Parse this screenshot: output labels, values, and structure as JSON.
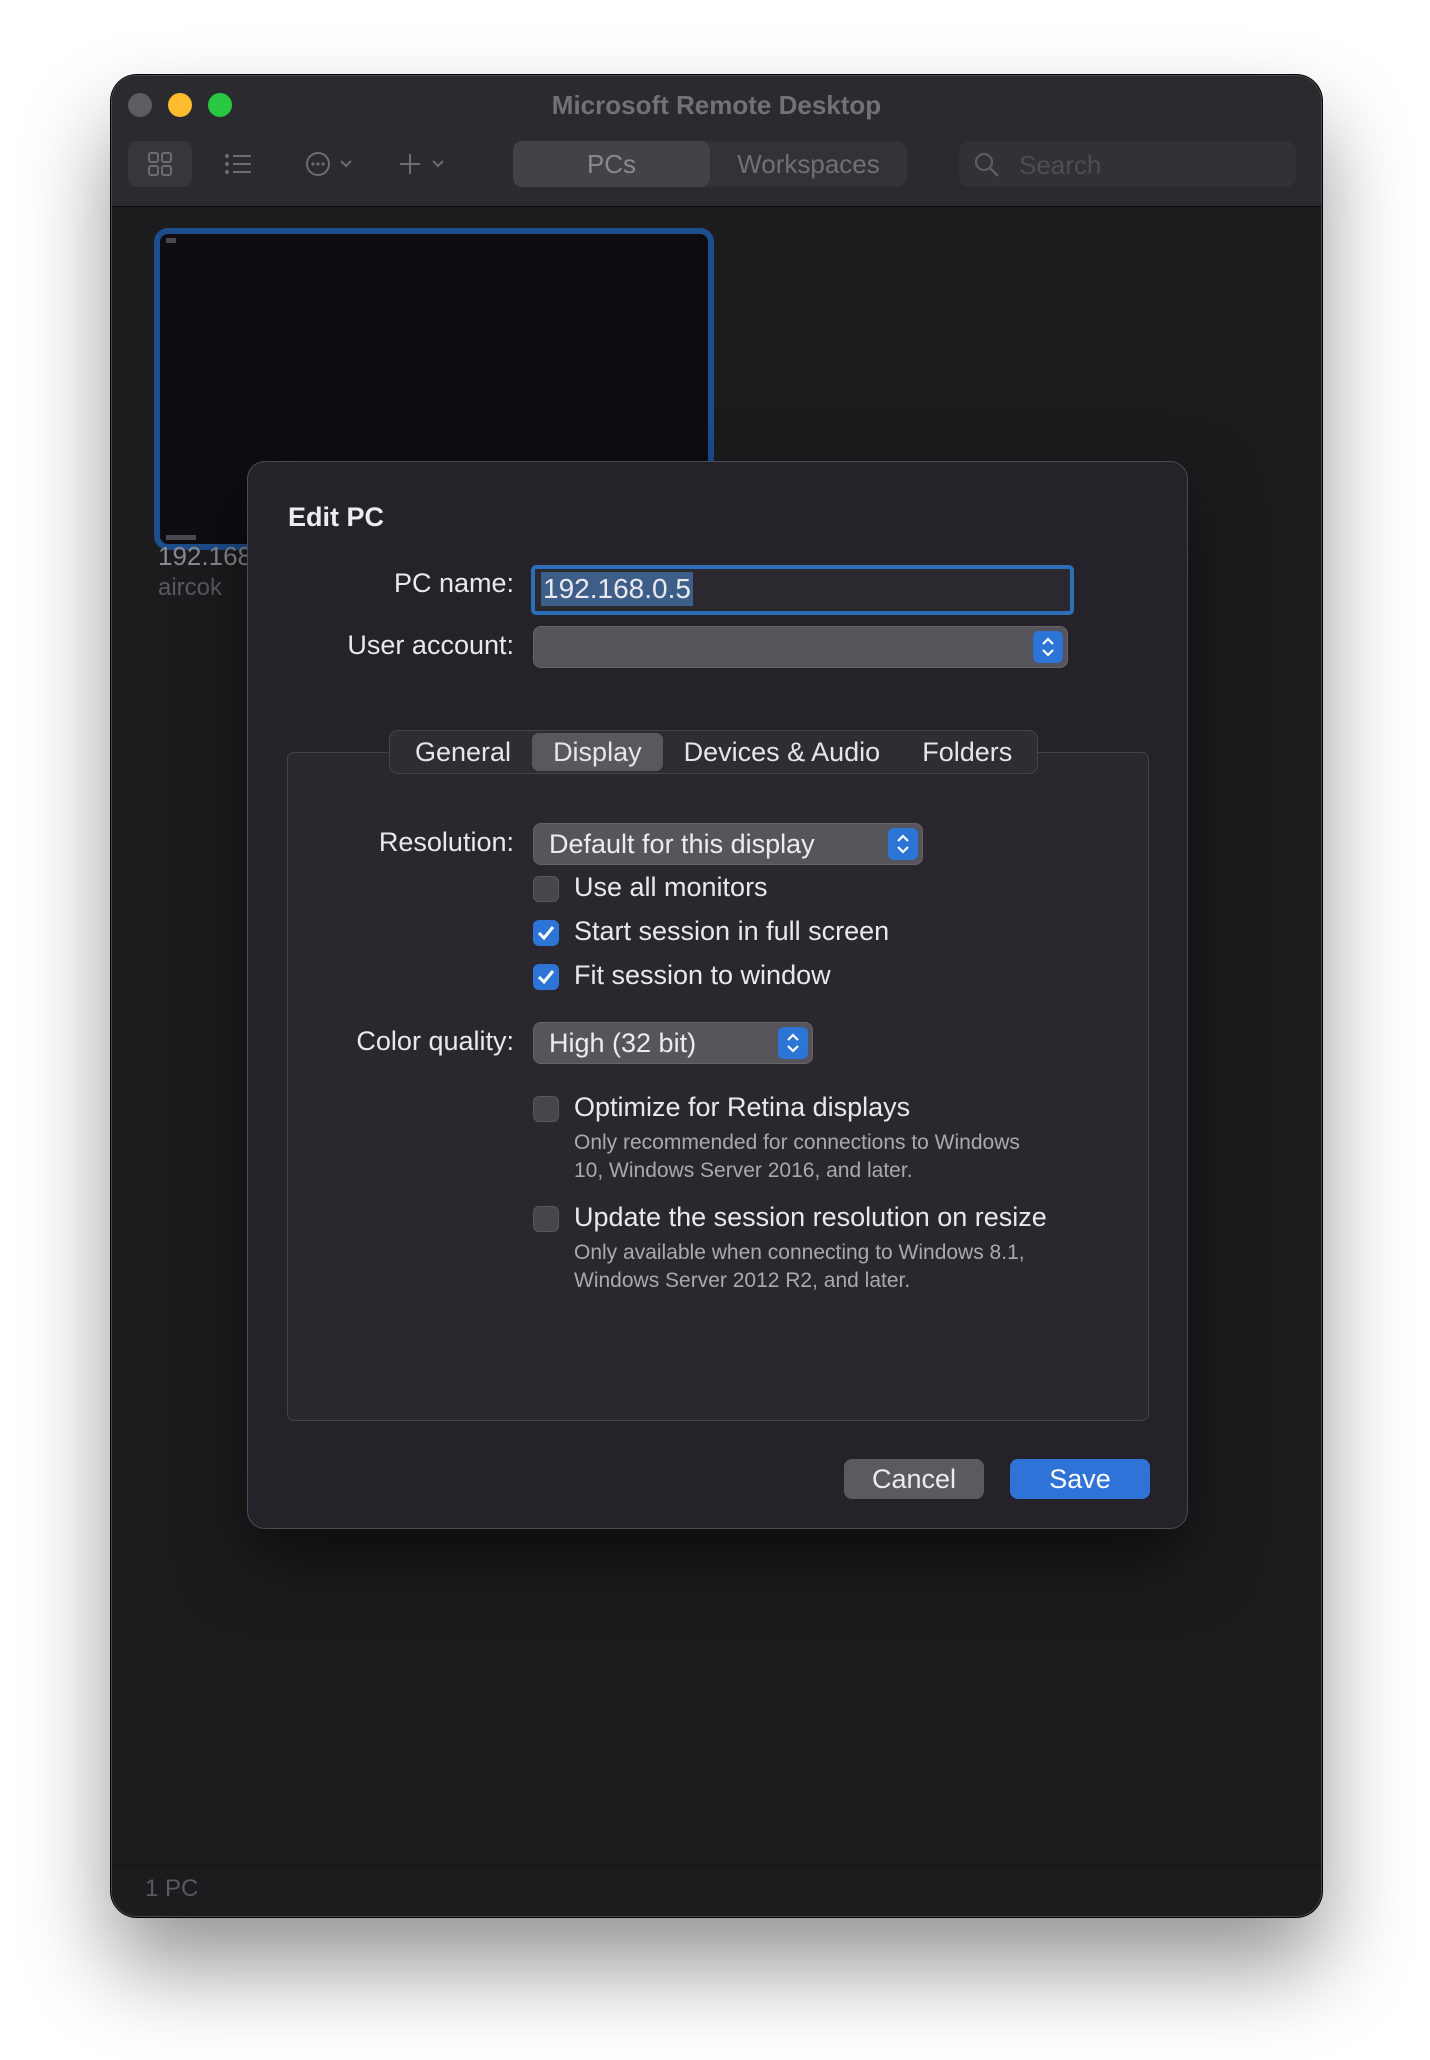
{
  "window": {
    "title": "Microsoft Remote Desktop"
  },
  "toolbar": {
    "icons": [
      "grid-view-icon",
      "list-view-icon",
      "more-options-icon",
      "add-icon"
    ],
    "segments": [
      "PCs",
      "Workspaces"
    ],
    "active_segment": "PCs",
    "search_placeholder": "Search"
  },
  "pc_tile": {
    "name": "192.168",
    "user": "aircok"
  },
  "status": {
    "count": "1 PC"
  },
  "dialog": {
    "title": "Edit PC",
    "pc_name_label": "PC name:",
    "pc_name_value": "192.168.0.5",
    "user_account_label": "User account:",
    "user_account_value": "",
    "tabs": [
      "General",
      "Display",
      "Devices & Audio",
      "Folders"
    ],
    "active_tab": "Display",
    "resolution_label": "Resolution:",
    "resolution_value": "Default for this display",
    "checks": [
      {
        "label": "Use all monitors",
        "checked": false
      },
      {
        "label": "Start session in full screen",
        "checked": true
      },
      {
        "label": "Fit session to window",
        "checked": true
      }
    ],
    "color_quality_label": "Color quality:",
    "color_quality_value": "High (32 bit)",
    "retina": {
      "label": "Optimize for Retina displays",
      "checked": false,
      "help_line1": "Only recommended for connections to Windows",
      "help_line2": "10, Windows Server 2016, and later."
    },
    "resize": {
      "label": "Update the session resolution on resize",
      "checked": false,
      "help_line1": "Only available when connecting to Windows 8.1,",
      "help_line2": "Windows Server 2012 R2, and later."
    },
    "cancel_label": "Cancel",
    "save_label": "Save"
  },
  "colors": {
    "accent": "#2c74d6",
    "window_bg": "#1c1c1e",
    "dialog_bg": "#252329"
  }
}
